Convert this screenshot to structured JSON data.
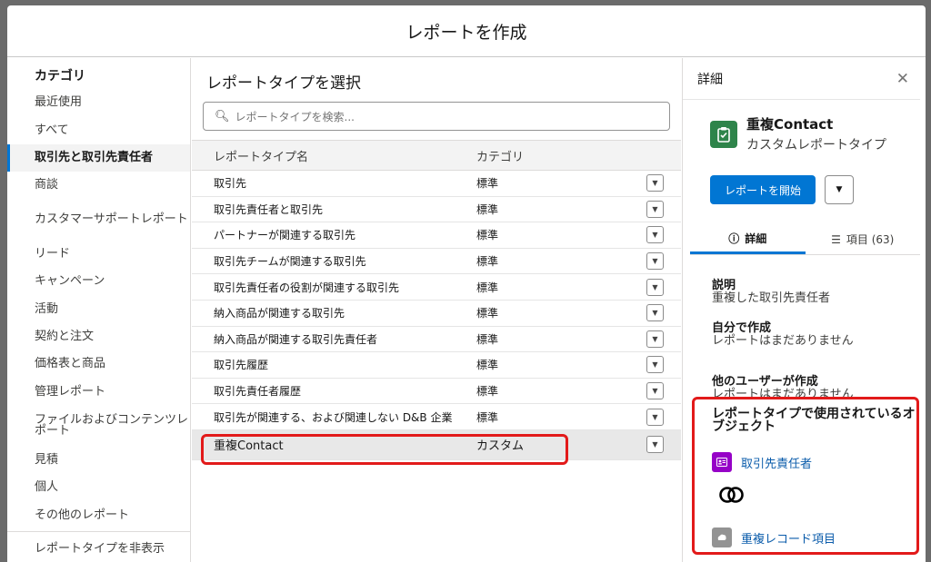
{
  "modal": {
    "title": "レポートを作成"
  },
  "categories": {
    "title": "カテゴリ",
    "items": [
      {
        "label": "最近使用"
      },
      {
        "label": "すべて"
      },
      {
        "label": "取引先と取引先責任者"
      },
      {
        "label": "商談"
      },
      {
        "label": "カスタマーサポートレポート"
      },
      {
        "label": "リード"
      },
      {
        "label": "キャンペーン"
      },
      {
        "label": "活動"
      },
      {
        "label": "契約と注文"
      },
      {
        "label": "価格表と商品"
      },
      {
        "label": "管理レポート"
      },
      {
        "label": "ファイルおよびコンテンツレポート"
      },
      {
        "label": "見積"
      },
      {
        "label": "個人"
      },
      {
        "label": "その他のレポート"
      }
    ],
    "active_index": 2,
    "hide_label": "レポートタイプを非表示"
  },
  "report_types": {
    "title": "レポートタイプを選択",
    "search_placeholder": "レポートタイプを検索...",
    "col_name": "レポートタイプ名",
    "col_category": "カテゴリ",
    "rows": [
      {
        "name": "取引先",
        "category": "標準"
      },
      {
        "name": "取引先責任者と取引先",
        "category": "標準"
      },
      {
        "name": "パートナーが関連する取引先",
        "category": "標準"
      },
      {
        "name": "取引先チームが関連する取引先",
        "category": "標準"
      },
      {
        "name": "取引先責任者の役割が関連する取引先",
        "category": "標準"
      },
      {
        "name": "納入商品が関連する取引先",
        "category": "標準"
      },
      {
        "name": "納入商品が関連する取引先責任者",
        "category": "標準"
      },
      {
        "name": "取引先履歴",
        "category": "標準"
      },
      {
        "name": "取引先責任者履歴",
        "category": "標準"
      },
      {
        "name": "取引先が関連する、および関連しない D&B 企業",
        "category": "標準"
      },
      {
        "name": "重複Contact",
        "category": "カスタム"
      }
    ],
    "selected_index": 10
  },
  "detail": {
    "header": "詳細",
    "close_icon": "close-icon",
    "object_name": "重複Contact",
    "object_sub": "カスタムレポートタイプ",
    "start_button": "レポートを開始",
    "tab_details": "詳細",
    "tab_fields": "項目 (63)",
    "description_label": "説明",
    "description_value": "重複した取引先責任者",
    "my_label": "自分で作成",
    "my_value": "レポートはまだありません",
    "others_label": "他のユーザーが作成",
    "others_value": "レポートはまだありません",
    "objects_title": "レポートタイプで使用されているオブジェクト",
    "objects": [
      {
        "label": "取引先責任者",
        "color": "#9602c7"
      },
      {
        "label": "重複レコード項目",
        "color": "#939393"
      }
    ]
  },
  "colors": {
    "brand": "#0176d3",
    "highlight": "#e21a1a",
    "object_icon": "#2e844a"
  }
}
